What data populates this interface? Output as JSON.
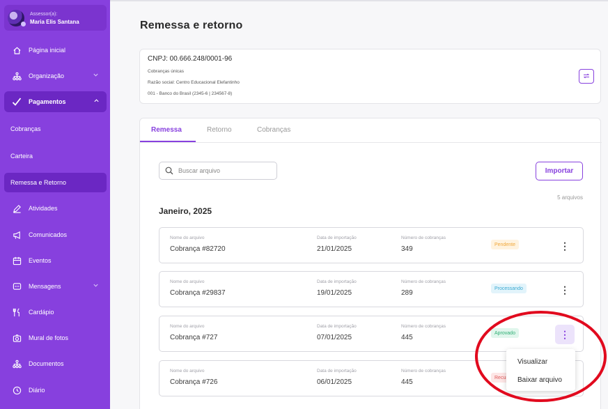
{
  "user": {
    "role": "Assessor(a):",
    "name": "Maria Elis Santana"
  },
  "sidebar": {
    "home": "Página inicial",
    "organizacao": "Organização",
    "pagamentos": "Pagamentos",
    "sub": [
      "Cobranças",
      "Carteira",
      "Remessa e Retorno"
    ],
    "atividades": "Atividades",
    "comunicados": "Comunicados",
    "eventos": "Eventos",
    "mensagens": "Mensagens",
    "cardapio": "Cardápio",
    "mural": "Mural de fotos",
    "documentos": "Documentos",
    "diario": "Diário"
  },
  "page": {
    "title": "Remessa e retorno"
  },
  "info": {
    "cnpj": "CNPJ: 00.666.248/0001-96",
    "tipo": "Cobranças únicas",
    "razao": "Razão social: Centro Educacional Elefantinho",
    "banco": "001 - Banco do Brasil (2345-6 | 234567-8)"
  },
  "tabs": [
    "Remessa",
    "Retorno",
    "Cobranças"
  ],
  "search": {
    "placeholder": "Buscar arquivo"
  },
  "import_label": "Importar",
  "file_count": "5 arquivos",
  "month": "Janeiro, 2025",
  "columns": {
    "name": "Nome do arquivo",
    "date": "Data de importação",
    "count": "Número de cobranças"
  },
  "rows": [
    {
      "name": "Cobrança #82720",
      "date": "21/01/2025",
      "count": "349",
      "status": "Pendente"
    },
    {
      "name": "Cobrança #29837",
      "date": "19/01/2025",
      "count": "289",
      "status": "Processando"
    },
    {
      "name": "Cobrança #727",
      "date": "07/01/2025",
      "count": "445",
      "status": "Aprovado"
    },
    {
      "name": "Cobrança #726",
      "date": "06/01/2025",
      "count": "445",
      "status": "Recus"
    }
  ],
  "menu": [
    "Visualizar",
    "Baixar arquivo"
  ],
  "colors": {
    "accent": "#8740de",
    "pendente_bg": "#fff3df",
    "pendente_fg": "#f0a73a",
    "processando_bg": "#e2f4fb",
    "processando_fg": "#3aa9d2",
    "aprovado_bg": "#e0f6ec",
    "aprovado_fg": "#2fae74",
    "recusado_bg": "#fde6e6",
    "recusado_fg": "#e05a5a"
  }
}
